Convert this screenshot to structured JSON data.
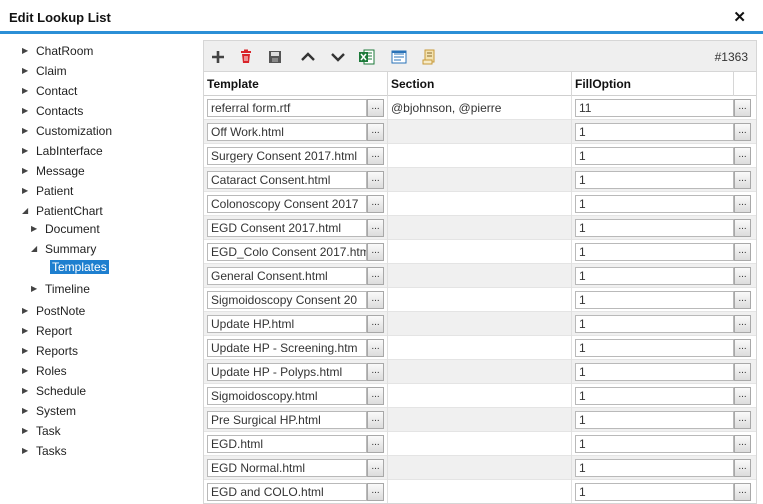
{
  "window": {
    "title": "Edit Lookup List",
    "close_glyph": "✕"
  },
  "tree": [
    {
      "label": "ChatRoom",
      "level": 0,
      "state": "collapsed"
    },
    {
      "label": "Claim",
      "level": 0,
      "state": "collapsed"
    },
    {
      "label": "Contact",
      "level": 0,
      "state": "collapsed"
    },
    {
      "label": "Contacts",
      "level": 0,
      "state": "collapsed"
    },
    {
      "label": "Customization",
      "level": 0,
      "state": "collapsed"
    },
    {
      "label": "LabInterface",
      "level": 0,
      "state": "collapsed"
    },
    {
      "label": "Message",
      "level": 0,
      "state": "collapsed"
    },
    {
      "label": "Patient",
      "level": 0,
      "state": "collapsed"
    },
    {
      "label": "PatientChart",
      "level": 0,
      "state": "expanded"
    },
    {
      "label": "Document",
      "level": 1,
      "state": "collapsed"
    },
    {
      "label": "Summary",
      "level": 1,
      "state": "expanded"
    },
    {
      "label": "Templates",
      "level": 2,
      "state": "leaf",
      "selected": true
    },
    {
      "label": "Timeline",
      "level": 1,
      "state": "collapsed"
    },
    {
      "label": "PostNote",
      "level": 0,
      "state": "collapsed"
    },
    {
      "label": "Report",
      "level": 0,
      "state": "collapsed"
    },
    {
      "label": "Reports",
      "level": 0,
      "state": "collapsed"
    },
    {
      "label": "Roles",
      "level": 0,
      "state": "collapsed"
    },
    {
      "label": "Schedule",
      "level": 0,
      "state": "collapsed"
    },
    {
      "label": "System",
      "level": 0,
      "state": "collapsed"
    },
    {
      "label": "Task",
      "level": 0,
      "state": "collapsed"
    },
    {
      "label": "Tasks",
      "level": 0,
      "state": "collapsed"
    }
  ],
  "toolbar": {
    "record_count": "#1363",
    "buttons": [
      "add-icon",
      "delete-icon",
      "save-icon",
      "move-up-icon",
      "move-down-icon",
      "excel-export-icon",
      "import-icon",
      "script-icon"
    ],
    "colors": {
      "add": "#444444",
      "delete": "#d9242a",
      "save": "#555555",
      "excel": "#1d7a3a",
      "import": "#2a73b8",
      "script": "#c79a3a"
    }
  },
  "grid": {
    "columns": [
      "Template",
      "Section",
      "FillOption"
    ],
    "ellipsis": "...",
    "rows": [
      {
        "template": "referral form.rtf",
        "section": "@bjohnson, @pierre",
        "fill": "11"
      },
      {
        "template": "Off Work.html",
        "section": "",
        "fill": "1"
      },
      {
        "template": "Surgery Consent 2017.html",
        "section": "",
        "fill": "1"
      },
      {
        "template": "Cataract Consent.html",
        "section": "",
        "fill": "1"
      },
      {
        "template": "Colonoscopy Consent 2017",
        "section": "",
        "fill": "1"
      },
      {
        "template": "EGD Consent 2017.html",
        "section": "",
        "fill": "1"
      },
      {
        "template": "EGD_Colo Consent 2017.htm",
        "section": "",
        "fill": "1"
      },
      {
        "template": "General Consent.html",
        "section": "",
        "fill": "1"
      },
      {
        "template": "Sigmoidoscopy Consent 20",
        "section": "",
        "fill": "1"
      },
      {
        "template": "Update HP.html",
        "section": "",
        "fill": "1"
      },
      {
        "template": "Update HP - Screening.htm",
        "section": "",
        "fill": "1"
      },
      {
        "template": "Update HP - Polyps.html",
        "section": "",
        "fill": "1"
      },
      {
        "template": "Sigmoidoscopy.html",
        "section": "",
        "fill": "1"
      },
      {
        "template": "Pre Surgical HP.html",
        "section": "",
        "fill": "1"
      },
      {
        "template": "EGD.html",
        "section": "",
        "fill": "1"
      },
      {
        "template": "EGD Normal.html",
        "section": "",
        "fill": "1"
      },
      {
        "template": "EGD and COLO.html",
        "section": "",
        "fill": "1"
      }
    ]
  }
}
